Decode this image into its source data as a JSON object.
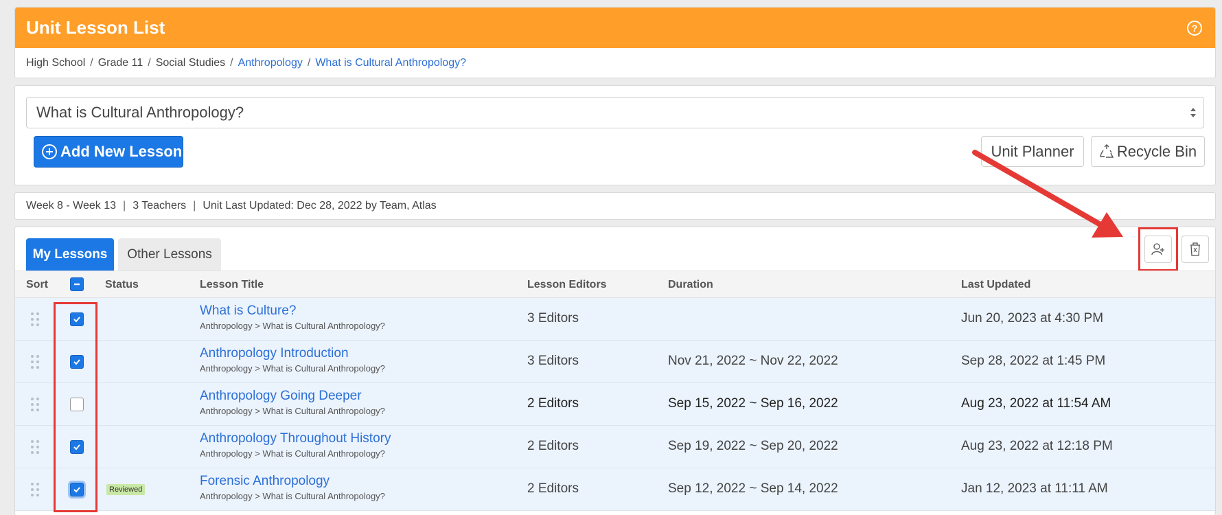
{
  "header": {
    "title": "Unit Lesson List",
    "help_icon": "question-circle-icon",
    "brand_color": "#ff9e28"
  },
  "breadcrumb": [
    {
      "label": "High School",
      "link": false
    },
    {
      "label": "Grade 11",
      "link": false
    },
    {
      "label": "Social Studies",
      "link": false
    },
    {
      "label": "Anthropology",
      "link": true
    },
    {
      "label": "What is Cultural Anthropology?",
      "link": true
    }
  ],
  "unit_select": {
    "value": "What is Cultural Anthropology?"
  },
  "toolbar": {
    "add_label": "Add New Lesson",
    "unit_planner_label": "Unit Planner",
    "recycle_bin_label": "Recycle Bin",
    "accent_color": "#1c78e4"
  },
  "info": {
    "weeks": "Week 8 - Week 13",
    "teachers": "3 Teachers",
    "updated": "Unit Last Updated: Dec 28, 2022 by Team, Atlas"
  },
  "tabs": [
    {
      "label": "My Lessons",
      "active": true
    },
    {
      "label": "Other Lessons",
      "active": false
    }
  ],
  "action_icons": [
    "add-user-icon",
    "trash-icon"
  ],
  "table": {
    "headers": {
      "sort": "Sort",
      "status": "Status",
      "title": "Lesson Title",
      "editors": "Lesson Editors",
      "duration": "Duration",
      "updated": "Last Updated"
    },
    "rows": [
      {
        "title": "What is Culture?",
        "path": "Anthropology > What is Cultural Anthropology?",
        "editors": "3 Editors",
        "duration": "",
        "updated": "Jun 20, 2023 at 4:30 PM",
        "checked": true,
        "status": ""
      },
      {
        "title": "Anthropology Introduction",
        "path": "Anthropology > What is Cultural Anthropology?",
        "editors": "3 Editors",
        "duration": "Nov 21, 2022 ~ Nov 22, 2022",
        "updated": "Sep 28, 2022 at 1:45 PM",
        "checked": true,
        "status": ""
      },
      {
        "title": "Anthropology Going Deeper",
        "path": "Anthropology > What is Cultural Anthropology?",
        "editors": "2 Editors",
        "duration": "Sep 15, 2022 ~ Sep 16, 2022",
        "updated": "Aug 23, 2022 at 11:54 AM",
        "checked": false,
        "status": ""
      },
      {
        "title": "Anthropology Throughout History",
        "path": "Anthropology > What is Cultural Anthropology?",
        "editors": "2 Editors",
        "duration": "Sep 19, 2022 ~ Sep 20, 2022",
        "updated": "Aug 23, 2022 at 12:18 PM",
        "checked": true,
        "status": ""
      },
      {
        "title": "Forensic Anthropology",
        "path": "Anthropology > What is Cultural Anthropology?",
        "editors": "2 Editors",
        "duration": "Sep 12, 2022 ~ Sep 14, 2022",
        "updated": "Jan 12, 2023 at 11:11 AM",
        "checked": true,
        "status": "Reviewed"
      }
    ]
  },
  "annotation_color": "#e53935"
}
